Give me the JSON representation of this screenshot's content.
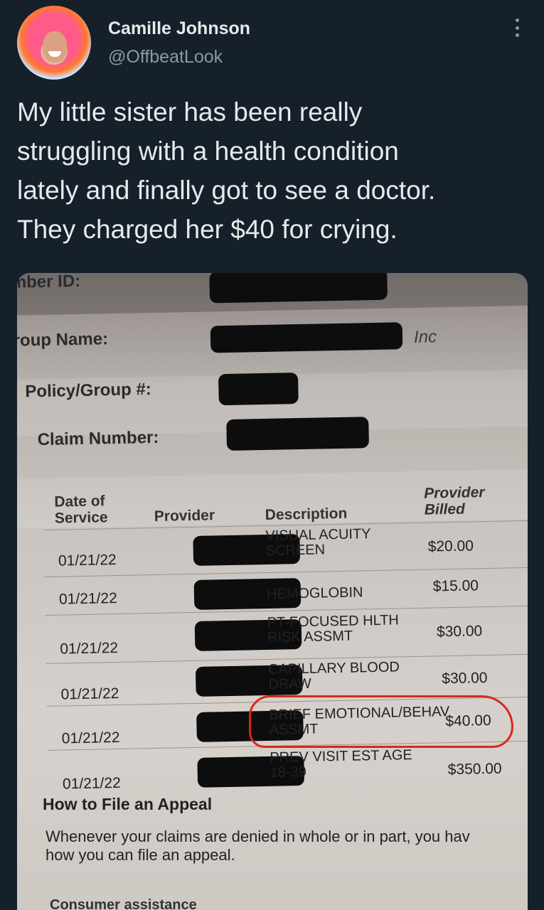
{
  "tweet": {
    "display_name": "Camille Johnson",
    "handle": "@OffbeatLook",
    "text": "My little sister has been really\nstruggling with a health condition\nlately and finally got to see a doctor.\nThey charged her $40 for crying.",
    "more_icon": "more-horizontal-icon"
  },
  "document": {
    "fields": {
      "member_id": "ember ID:",
      "group_name": "Group Name:",
      "group_name_suffix": "Inc",
      "policy_group": "Policy/Group #:",
      "claim_number": "Claim Number:"
    },
    "columns": {
      "date": "Date of\nService",
      "provider": "Provider",
      "description": "Description",
      "billed": "Provider\nBilled"
    },
    "rows": [
      {
        "date": "01/21/22",
        "description": "VISUAL ACUITY\nSCREEN",
        "amount": "$20.00"
      },
      {
        "date": "01/21/22",
        "description": "HEMOGLOBIN",
        "amount": "$15.00"
      },
      {
        "date": "01/21/22",
        "description": "PT-FOCUSED HLTH\nRISK ASSMT",
        "amount": "$30.00"
      },
      {
        "date": "01/21/22",
        "description": "CAPILLARY BLOOD\nDRAW",
        "amount": "$30.00"
      },
      {
        "date": "01/21/22",
        "description": "BRIEF EMOTIONAL/BEHAV\nASSMT",
        "amount": "$40.00"
      },
      {
        "date": "01/21/22",
        "description": "PREV VISIT EST AGE\n18-39",
        "amount": "$350.00"
      }
    ],
    "appeal_heading": "How to File an Appeal",
    "appeal_text": "Whenever your claims are denied in whole or in part, you hav\nhow you can file an appeal.",
    "consumer_text": "Consumer assistance"
  },
  "highlight_color": "#d9281c"
}
